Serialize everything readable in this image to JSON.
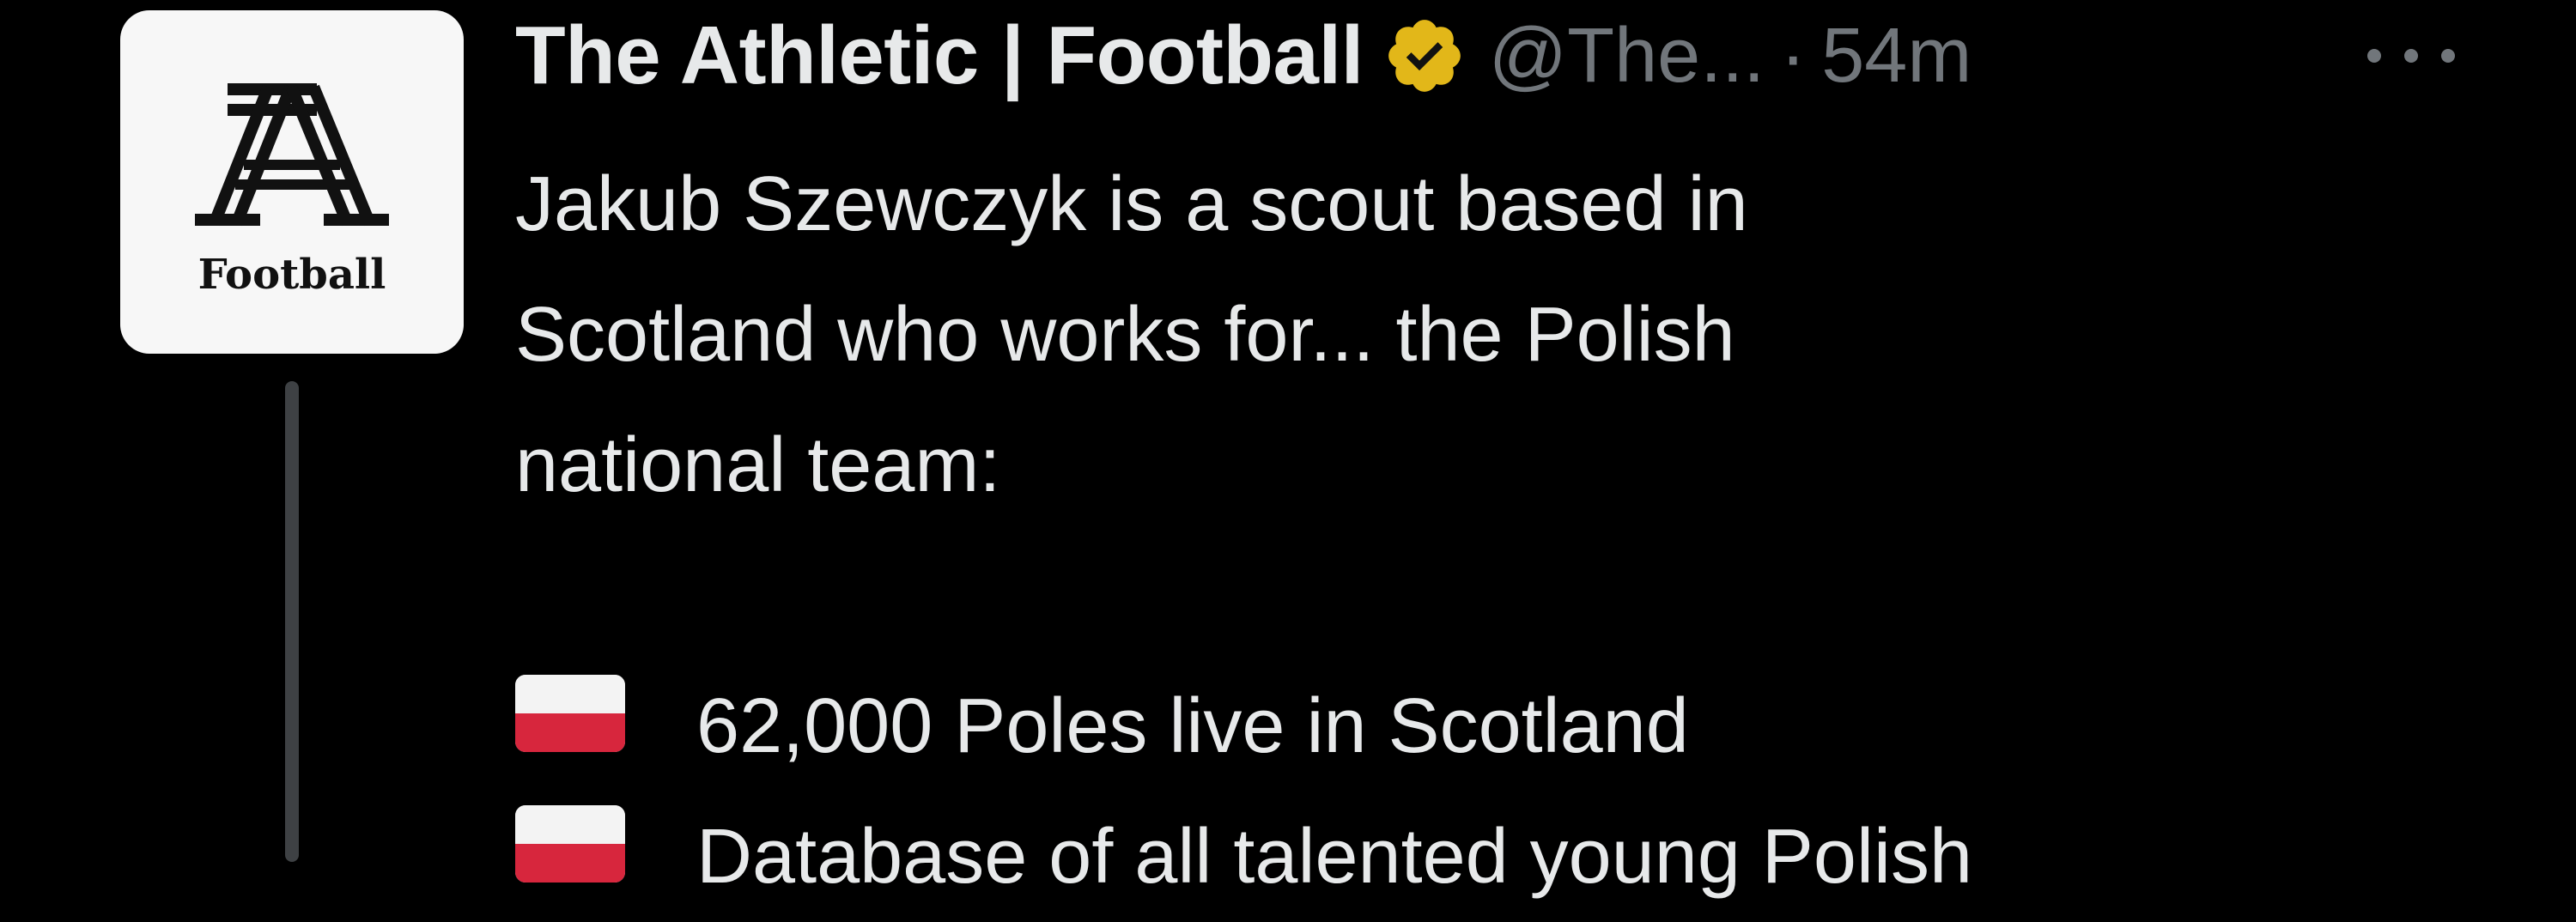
{
  "tweet": {
    "avatar": {
      "logo_text": "Football",
      "icon": "the-athletic-logo-icon"
    },
    "author": {
      "display_name": "The Athletic | Football",
      "verified_icon": "verified-gold-badge-icon",
      "handle": "@The...",
      "separator": "·",
      "time": "54m"
    },
    "more_icon": "more-options-icon",
    "text": {
      "line1": "Jakub Szewczyk is a scout based in",
      "line2": "Scotland who works for... the Polish",
      "line3": "national team:",
      "bullets": [
        {
          "flag_icon": "poland-flag-icon",
          "text": "62,000 Poles live in Scotland"
        },
        {
          "flag_icon": "poland-flag-icon",
          "text": "Database of all talented young Polish"
        }
      ]
    },
    "colors": {
      "background": "#000000",
      "primary_text": "#e7e9ea",
      "secondary_text": "#71767b",
      "verified_badge": "#e2b719",
      "thread_line": "#3e4144"
    }
  }
}
